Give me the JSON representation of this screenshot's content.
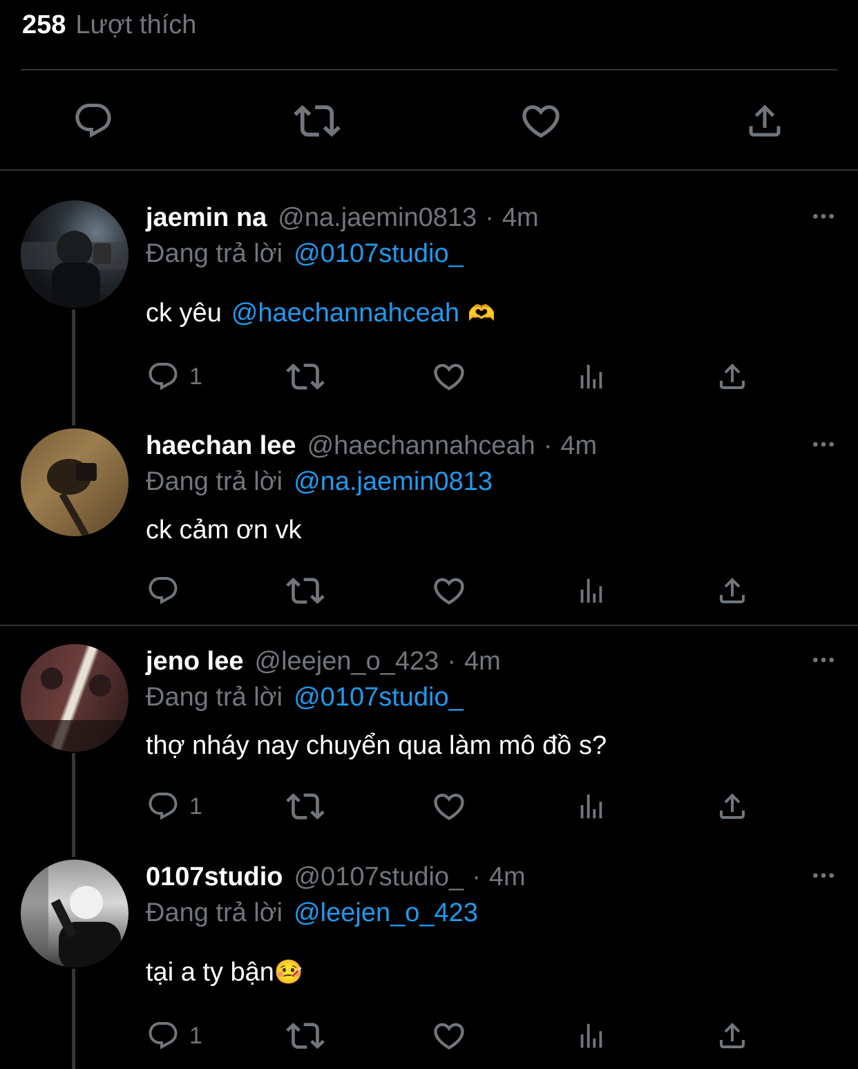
{
  "likes": {
    "count": "258",
    "label": "Lượt thích"
  },
  "main_actions": {
    "icons": [
      "reply-icon",
      "retweet-icon",
      "like-icon",
      "share-icon"
    ]
  },
  "tweets": [
    {
      "name": "jaemin na",
      "handle": "@na.jaemin0813",
      "dot": "·",
      "time": "4m",
      "reply_label": "Đang trả lời",
      "reply_to": "@0107studio_",
      "text": "ck yêu",
      "mention": "@haechannahceah",
      "emoji": "🫶",
      "reply_count": "1"
    },
    {
      "name": "haechan lee",
      "handle": "@haechannahceah",
      "dot": "·",
      "time": "4m",
      "reply_label": "Đang trả lời",
      "reply_to": "@na.jaemin0813",
      "text": "ck cảm ơn vk",
      "reply_count": ""
    },
    {
      "name": "jeno lee",
      "handle": "@leejen_o_423",
      "dot": "·",
      "time": "4m",
      "reply_label": "Đang trả lời",
      "reply_to": "@0107studio_",
      "text": "thợ nháy nay chuyển qua làm mô đồ s?",
      "reply_count": "1"
    },
    {
      "name": "0107studio",
      "handle": "@0107studio_",
      "dot": "·",
      "time": "4m",
      "reply_label": "Đang trả lời",
      "reply_to": "@leejen_o_423",
      "text": "tại a ty bận",
      "emoji": "🤒",
      "reply_count": "1"
    }
  ],
  "colors": {
    "background": "#000000",
    "text": "#e7e9ea",
    "muted": "#71767b",
    "link": "#1d9bf0",
    "divider": "#2f3336"
  }
}
